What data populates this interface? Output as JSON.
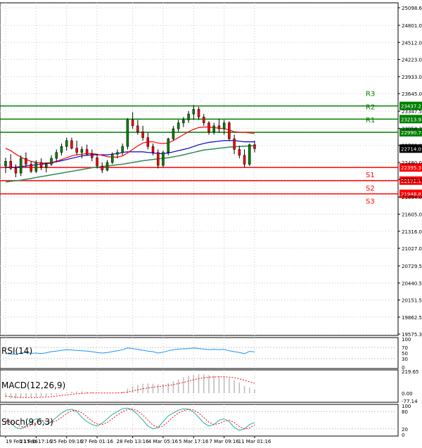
{
  "chart_data": [
    {
      "type": "candlestick",
      "title": "",
      "ylim": [
        19575.3,
        25098.6
      ],
      "y_ticks": [
        "25098.6",
        "24801.0",
        "24512.0",
        "24223.0",
        "23933.0",
        "23645.0",
        "23347.5",
        "23058.2",
        "22769.0",
        "22480.0",
        "22191.4",
        "21894.0",
        "21605.0",
        "21316.0",
        "21027.0",
        "20729.5",
        "20440.5",
        "20151.5",
        "19862.5",
        "19575.3"
      ],
      "x_ticks": [
        "19 Feb 15:16",
        "21 Feb 17:16",
        "25 Feb 09:16",
        "27 Feb 01:16",
        "28 Feb 13:16",
        "4 Mar 05:16",
        "5 Mar 17:16",
        "7 Mar 09:16",
        "11 Mar 01:16"
      ],
      "current_price": "22714.0",
      "levels": [
        {
          "name": "R3",
          "value": 23437.2,
          "label": "23437.2",
          "color": "#008000"
        },
        {
          "name": "R2",
          "value": 23213.9,
          "label": "23213.9",
          "color": "#008000"
        },
        {
          "name": "R1",
          "value": 22990.7,
          "label": "22990.7",
          "color": "#008000"
        },
        {
          "name": "S1",
          "value": 22395.3,
          "label": "22395.3",
          "color": "#ff0000"
        },
        {
          "name": "S2",
          "value": 22172.1,
          "label": "22172.1",
          "color": "#ff0000"
        },
        {
          "name": "S3",
          "value": 21948.8,
          "label": "21948.8",
          "color": "#ff0000"
        }
      ],
      "candles": [
        {
          "o": 22420,
          "h": 22560,
          "l": 22300,
          "c": 22500
        },
        {
          "o": 22500,
          "h": 22620,
          "l": 22350,
          "c": 22380
        },
        {
          "o": 22380,
          "h": 22450,
          "l": 22230,
          "c": 22300
        },
        {
          "o": 22300,
          "h": 22600,
          "l": 22250,
          "c": 22550
        },
        {
          "o": 22550,
          "h": 22650,
          "l": 22400,
          "c": 22450
        },
        {
          "o": 22450,
          "h": 22500,
          "l": 22300,
          "c": 22330
        },
        {
          "o": 22330,
          "h": 22520,
          "l": 22300,
          "c": 22480
        },
        {
          "o": 22480,
          "h": 22550,
          "l": 22350,
          "c": 22400
        },
        {
          "o": 22400,
          "h": 22480,
          "l": 22310,
          "c": 22450
        },
        {
          "o": 22450,
          "h": 22600,
          "l": 22420,
          "c": 22550
        },
        {
          "o": 22550,
          "h": 22700,
          "l": 22500,
          "c": 22650
        },
        {
          "o": 22650,
          "h": 22800,
          "l": 22600,
          "c": 22750
        },
        {
          "o": 22750,
          "h": 22900,
          "l": 22680,
          "c": 22850
        },
        {
          "o": 22850,
          "h": 22900,
          "l": 22700,
          "c": 22720
        },
        {
          "o": 22720,
          "h": 22850,
          "l": 22600,
          "c": 22650
        },
        {
          "o": 22650,
          "h": 22750,
          "l": 22550,
          "c": 22700
        },
        {
          "o": 22700,
          "h": 22780,
          "l": 22600,
          "c": 22620
        },
        {
          "o": 22620,
          "h": 22700,
          "l": 22500,
          "c": 22560
        },
        {
          "o": 22560,
          "h": 22620,
          "l": 22380,
          "c": 22420
        },
        {
          "o": 22420,
          "h": 22480,
          "l": 22300,
          "c": 22350
        },
        {
          "o": 22350,
          "h": 22520,
          "l": 22330,
          "c": 22480
        },
        {
          "o": 22480,
          "h": 22650,
          "l": 22450,
          "c": 22620
        },
        {
          "o": 22620,
          "h": 22700,
          "l": 22550,
          "c": 22650
        },
        {
          "o": 22650,
          "h": 22800,
          "l": 22600,
          "c": 22750
        },
        {
          "o": 22750,
          "h": 23230,
          "l": 22700,
          "c": 23200
        },
        {
          "o": 23200,
          "h": 23330,
          "l": 23050,
          "c": 23100
        },
        {
          "o": 23100,
          "h": 23200,
          "l": 22950,
          "c": 23000
        },
        {
          "o": 23000,
          "h": 23100,
          "l": 22850,
          "c": 22900
        },
        {
          "o": 22900,
          "h": 22980,
          "l": 22700,
          "c": 22750
        },
        {
          "o": 22750,
          "h": 22800,
          "l": 22600,
          "c": 22650
        },
        {
          "o": 22650,
          "h": 22700,
          "l": 22380,
          "c": 22430
        },
        {
          "o": 22430,
          "h": 22680,
          "l": 22400,
          "c": 22650
        },
        {
          "o": 22650,
          "h": 22900,
          "l": 22600,
          "c": 22880
        },
        {
          "o": 22880,
          "h": 23100,
          "l": 22850,
          "c": 23050
        },
        {
          "o": 23050,
          "h": 23200,
          "l": 23000,
          "c": 23150
        },
        {
          "o": 23150,
          "h": 23250,
          "l": 23080,
          "c": 23200
        },
        {
          "o": 23200,
          "h": 23350,
          "l": 23150,
          "c": 23300
        },
        {
          "o": 23300,
          "h": 23450,
          "l": 23200,
          "c": 23380
        },
        {
          "o": 23380,
          "h": 23420,
          "l": 23200,
          "c": 23250
        },
        {
          "o": 23250,
          "h": 23300,
          "l": 23100,
          "c": 23150
        },
        {
          "o": 23150,
          "h": 23180,
          "l": 22950,
          "c": 23000
        },
        {
          "o": 23000,
          "h": 23150,
          "l": 22950,
          "c": 23100
        },
        {
          "o": 23100,
          "h": 23220,
          "l": 22980,
          "c": 23050
        },
        {
          "o": 23050,
          "h": 23200,
          "l": 22950,
          "c": 23150
        },
        {
          "o": 23150,
          "h": 23180,
          "l": 22850,
          "c": 22880
        },
        {
          "o": 22880,
          "h": 22950,
          "l": 22620,
          "c": 22700
        },
        {
          "o": 22700,
          "h": 22760,
          "l": 22550,
          "c": 22600
        },
        {
          "o": 22600,
          "h": 22700,
          "l": 22400,
          "c": 22450
        },
        {
          "o": 22450,
          "h": 22800,
          "l": 22420,
          "c": 22780
        },
        {
          "o": 22780,
          "h": 22850,
          "l": 22650,
          "c": 22714
        }
      ],
      "ma_fast": [
        22720,
        22680,
        22620,
        22570,
        22530,
        22500,
        22480,
        22470,
        22470,
        22480,
        22500,
        22530,
        22560,
        22590,
        22610,
        22620,
        22630,
        22630,
        22620,
        22600,
        22580,
        22570,
        22570,
        22590,
        22640,
        22700,
        22760,
        22810,
        22830,
        22830,
        22810,
        22800,
        22810,
        22850,
        22900,
        22950,
        23000,
        23040,
        23070,
        23080,
        23080,
        23070,
        23060,
        23050,
        23030,
        23000,
        22990,
        22990,
        22980,
        22970
      ],
      "ma_mid": [
        22400,
        22400,
        22400,
        22410,
        22420,
        22430,
        22440,
        22450,
        22460,
        22470,
        22490,
        22510,
        22530,
        22550,
        22570,
        22590,
        22600,
        22610,
        22610,
        22610,
        22610,
        22620,
        22630,
        22650,
        22660,
        22660,
        22660,
        22660,
        22650,
        22640,
        22630,
        22630,
        22640,
        22660,
        22680,
        22700,
        22720,
        22750,
        22780,
        22800,
        22820,
        22830,
        22840,
        22850,
        22850,
        22850,
        22840,
        22830,
        22830,
        22830
      ],
      "ma_slow": [
        22150,
        22160,
        22170,
        22180,
        22195,
        22210,
        22225,
        22240,
        22255,
        22270,
        22285,
        22300,
        22315,
        22330,
        22345,
        22360,
        22375,
        22390,
        22400,
        22410,
        22420,
        22430,
        22440,
        22450,
        22465,
        22480,
        22495,
        22510,
        22520,
        22530,
        22540,
        22550,
        22560,
        22575,
        22590,
        22610,
        22630,
        22650,
        22670,
        22690,
        22700,
        22710,
        22720,
        22730,
        22740,
        22745,
        22750,
        22755,
        22760,
        22765
      ],
      "colors": {
        "bull": "#008000",
        "bear": "#ff0000",
        "ma_fast": "#ff0000",
        "ma_mid": "#0000cc",
        "ma_slow": "#2e8b57"
      }
    },
    {
      "type": "line",
      "name": "RSI(14)",
      "ylim": [
        0,
        100
      ],
      "y_ticks": [
        "100",
        "70",
        "50",
        "30",
        "0"
      ],
      "tick_values": [
        100,
        70,
        50,
        30,
        0
      ],
      "values": [
        48,
        47,
        46,
        50,
        52,
        49,
        50,
        48,
        51,
        55,
        57,
        60,
        62,
        61,
        59,
        58,
        57,
        55,
        52,
        50,
        52,
        55,
        58,
        62,
        68,
        66,
        63,
        60,
        57,
        55,
        50,
        53,
        58,
        62,
        64,
        65,
        66,
        68,
        66,
        64,
        62,
        63,
        62,
        63,
        58,
        55,
        52,
        48,
        56,
        54
      ],
      "color": "#1e90ff"
    },
    {
      "type": "bar",
      "name": "MACD(12,26,9)",
      "ylim": [
        -77.14,
        219.65
      ],
      "y_ticks": [
        "219.65",
        "0.00",
        "-77.14"
      ],
      "tick_values": [
        219.65,
        0,
        -77.14
      ],
      "histogram": [
        -40,
        -50,
        -55,
        -50,
        -45,
        -42,
        -40,
        -38,
        -30,
        -20,
        -10,
        0,
        10,
        15,
        18,
        18,
        15,
        10,
        5,
        0,
        -3,
        0,
        5,
        15,
        45,
        70,
        85,
        95,
        98,
        95,
        90,
        92,
        100,
        120,
        140,
        160,
        175,
        185,
        190,
        188,
        180,
        175,
        170,
        165,
        150,
        130,
        105,
        70,
        55,
        40
      ],
      "signal": [
        -30,
        -35,
        -40,
        -42,
        -44,
        -44,
        -43,
        -41,
        -38,
        -34,
        -29,
        -23,
        -17,
        -11,
        -6,
        -2,
        1,
        3,
        3,
        3,
        2,
        2,
        3,
        5,
        12,
        22,
        33,
        44,
        53,
        61,
        67,
        72,
        78,
        86,
        97,
        109,
        122,
        135,
        147,
        155,
        160,
        163,
        165,
        165,
        162,
        155,
        145,
        130,
        115,
        100
      ],
      "colors": {
        "histogram": "#bbbbbb",
        "signal": "#ff0000"
      }
    },
    {
      "type": "line",
      "name": "Stoch(9,6,3)",
      "ylim": [
        0,
        100
      ],
      "y_ticks": [
        "100",
        "80",
        "20",
        "0"
      ],
      "tick_values": [
        100,
        80,
        20,
        0
      ],
      "k": [
        50,
        40,
        25,
        20,
        30,
        45,
        55,
        50,
        35,
        45,
        60,
        75,
        85,
        88,
        80,
        60,
        45,
        35,
        30,
        40,
        55,
        70,
        80,
        90,
        92,
        85,
        70,
        50,
        30,
        20,
        25,
        45,
        65,
        75,
        85,
        90,
        88,
        78,
        60,
        40,
        30,
        35,
        50,
        55,
        45,
        25,
        15,
        20,
        35,
        42
      ],
      "d": [
        45,
        45,
        38,
        28,
        25,
        32,
        42,
        50,
        47,
        43,
        48,
        60,
        73,
        83,
        84,
        76,
        62,
        47,
        37,
        35,
        42,
        55,
        68,
        80,
        87,
        89,
        82,
        68,
        50,
        33,
        25,
        30,
        45,
        62,
        75,
        83,
        88,
        85,
        75,
        59,
        43,
        35,
        38,
        47,
        50,
        42,
        28,
        20,
        23,
        33
      ],
      "colors": {
        "k": "#20b2aa",
        "d": "#ff0000"
      }
    }
  ]
}
